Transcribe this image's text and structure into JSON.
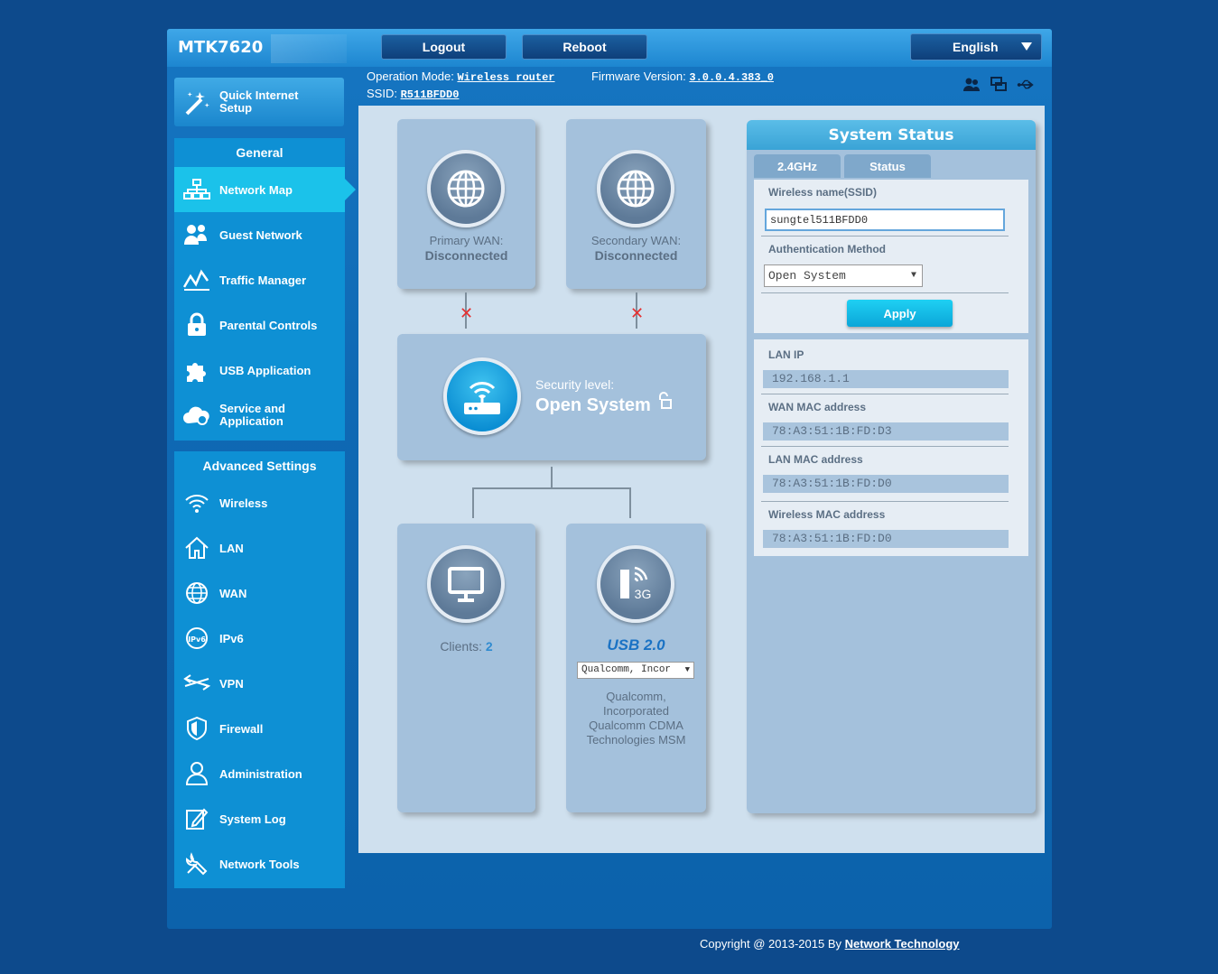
{
  "header": {
    "model": "MTK7620",
    "logout_label": "Logout",
    "reboot_label": "Reboot",
    "language": "English",
    "op_mode_label": "Operation Mode:",
    "op_mode_value": "Wireless router",
    "firmware_label": "Firmware Version:",
    "firmware_value": "3.0.0.4.383_0",
    "ssid_label": "SSID:",
    "ssid_value": "R511BFDD0"
  },
  "sidebar": {
    "quick_setup": "Quick Internet Setup",
    "general_title": "General",
    "general_items": [
      {
        "label": "Network Map",
        "icon": "network-map-icon"
      },
      {
        "label": "Guest Network",
        "icon": "guest-network-icon"
      },
      {
        "label": "Traffic Manager",
        "icon": "traffic-manager-icon"
      },
      {
        "label": "Parental Controls",
        "icon": "lock-icon"
      },
      {
        "label": "USB Application",
        "icon": "puzzle-icon"
      },
      {
        "label": "Service and Application",
        "icon": "cloud-icon"
      }
    ],
    "advanced_title": "Advanced Settings",
    "advanced_items": [
      {
        "label": "Wireless",
        "icon": "wifi-icon"
      },
      {
        "label": "LAN",
        "icon": "home-icon"
      },
      {
        "label": "WAN",
        "icon": "globe-icon"
      },
      {
        "label": "IPv6",
        "icon": "ipv6-icon"
      },
      {
        "label": "VPN",
        "icon": "vpn-icon"
      },
      {
        "label": "Firewall",
        "icon": "shield-icon"
      },
      {
        "label": "Administration",
        "icon": "user-icon"
      },
      {
        "label": "System Log",
        "icon": "log-icon"
      },
      {
        "label": "Network Tools",
        "icon": "tools-icon"
      }
    ]
  },
  "map": {
    "primary_wan_label": "Primary WAN:",
    "primary_wan_status": "Disconnected",
    "secondary_wan_label": "Secondary WAN:",
    "secondary_wan_status": "Disconnected",
    "security_label": "Security level:",
    "security_value": "Open System",
    "clients_label": "Clients:",
    "clients_count": "2",
    "usb_title": "USB 2.0",
    "usb_select": "Qualcomm, Incor",
    "usb_desc_1": "Qualcomm,",
    "usb_desc_2": "Incorporated",
    "usb_desc_3": "Qualcomm CDMA",
    "usb_desc_4": "Technologies MSM",
    "usb_badge": "3G"
  },
  "status": {
    "title": "System Status",
    "tab_24": "2.4GHz",
    "tab_status": "Status",
    "ssid_label": "Wireless name(SSID)",
    "ssid_value": "sungtel511BFDD0",
    "auth_label": "Authentication Method",
    "auth_value": "Open System",
    "apply_label": "Apply",
    "lan_ip_label": "LAN IP",
    "lan_ip": "192.168.1.1",
    "wan_mac_label": "WAN MAC address",
    "wan_mac": "78:A3:51:1B:FD:D3",
    "lan_mac_label": "LAN MAC address",
    "lan_mac": "78:A3:51:1B:FD:D0",
    "wl_mac_label": "Wireless MAC address",
    "wl_mac": "78:A3:51:1B:FD:D0"
  },
  "footer": {
    "copyright": "Copyright @ 2013-2015 By",
    "link": "Network Technology"
  }
}
